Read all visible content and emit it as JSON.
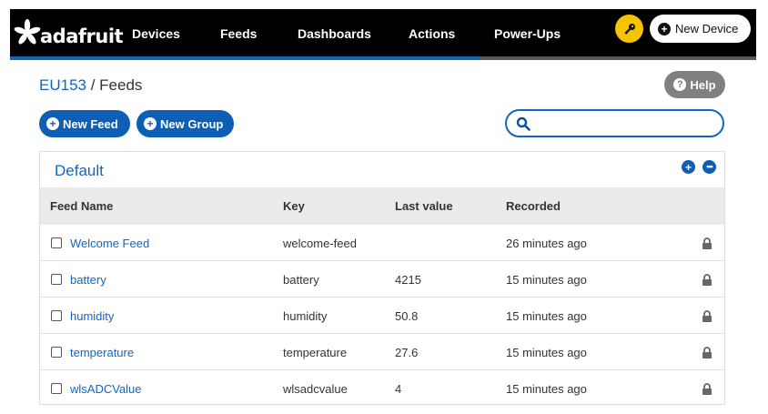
{
  "header": {
    "logo_text": "adafruit",
    "nav": [
      "Devices",
      "Feeds",
      "Dashboards",
      "Actions",
      "Power-Ups"
    ],
    "new_device_label": "New Device",
    "accent_color": "#1565c0",
    "key_button_color": "#f5c400"
  },
  "breadcrumb": {
    "user": "EU153",
    "separator": " / ",
    "page": "Feeds"
  },
  "help_label": "Help",
  "toolbar": {
    "new_feed_label": "New Feed",
    "new_group_label": "New Group",
    "search_placeholder": ""
  },
  "group": {
    "title": "Default",
    "columns": [
      "Feed Name",
      "Key",
      "Last value",
      "Recorded"
    ],
    "feeds": [
      {
        "name": "Welcome Feed",
        "key": "welcome-feed",
        "last_value": "",
        "recorded": "26 minutes ago"
      },
      {
        "name": "battery",
        "key": "battery",
        "last_value": "4215",
        "recorded": "15 minutes ago"
      },
      {
        "name": "humidity",
        "key": "humidity",
        "last_value": "50.8",
        "recorded": "15 minutes ago"
      },
      {
        "name": "temperature",
        "key": "temperature",
        "last_value": "27.6",
        "recorded": "15 minutes ago"
      },
      {
        "name": "wlsADCValue",
        "key": "wlsadcvalue",
        "last_value": "4",
        "recorded": "15 minutes ago"
      }
    ]
  }
}
